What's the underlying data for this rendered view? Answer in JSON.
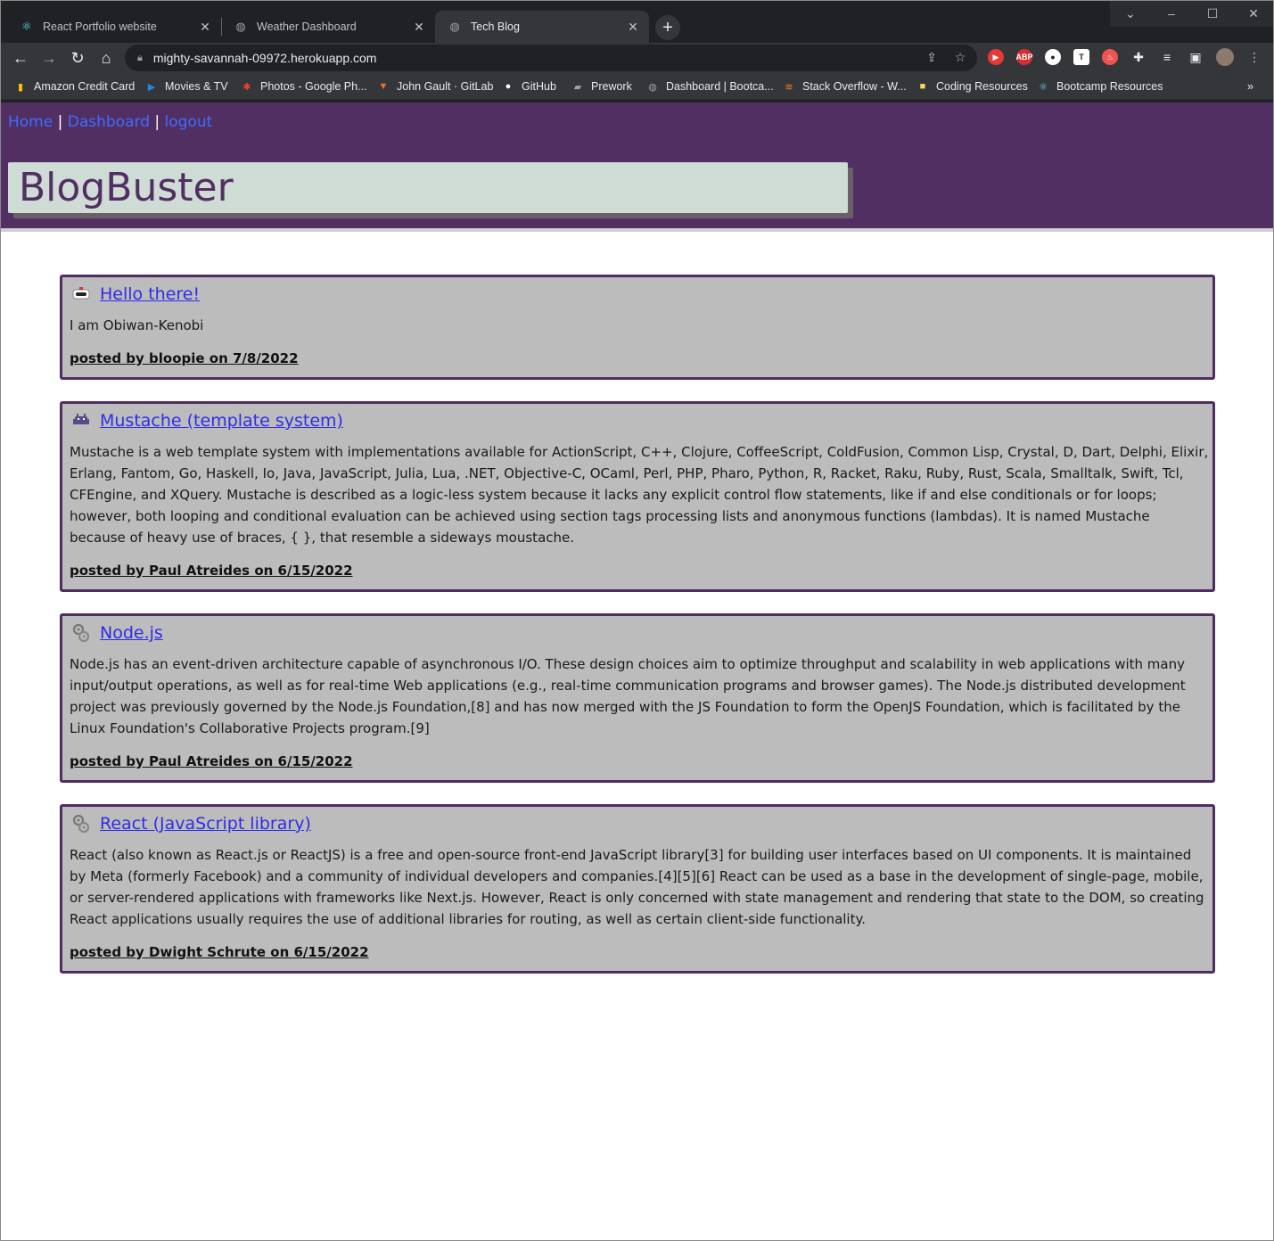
{
  "browser": {
    "tabs": [
      {
        "label": "React Portfolio website",
        "icon": "react-icon",
        "active": false
      },
      {
        "label": "Weather Dashboard",
        "icon": "globe-icon",
        "active": false
      },
      {
        "label": "Tech Blog",
        "icon": "globe-icon",
        "active": true
      }
    ],
    "url": "mighty-savannah-09972.herokuapp.com",
    "bookmarks": [
      {
        "label": "Amazon Credit Card",
        "icon": "chart-bars-icon"
      },
      {
        "label": "Movies & TV",
        "icon": "play-icon"
      },
      {
        "label": "Photos - Google Ph...",
        "icon": "pinwheel-icon"
      },
      {
        "label": "John Gault · GitLab",
        "icon": "gitlab-icon"
      },
      {
        "label": "GitHub",
        "icon": "github-icon"
      },
      {
        "label": "Prework",
        "icon": "book-icon"
      },
      {
        "label": "Dashboard | Bootca...",
        "icon": "globe-icon"
      },
      {
        "label": "Stack Overflow - W...",
        "icon": "stackoverflow-icon"
      },
      {
        "label": "Coding Resources",
        "icon": "folder-icon"
      },
      {
        "label": "Bootcamp Resources",
        "icon": "react-icon"
      }
    ],
    "bookmarks_overflow": "»"
  },
  "site": {
    "nav": {
      "home": "Home",
      "sep1": " | ",
      "dashboard": "Dashboard",
      "sep2": " | ",
      "logout": "logout"
    },
    "brand": "BlogBuster",
    "colors": {
      "header": "#522f63",
      "brand_box": "#cfdbd5",
      "post_bg": "#bcbcbc",
      "link": "#2f2de8"
    }
  },
  "posts": [
    {
      "title": "Hello there!",
      "icon": "robot-icon",
      "body": "I am Obiwan-Kenobi",
      "meta": "posted by bloopie on 7/8/2022"
    },
    {
      "title": "Mustache (template system)",
      "icon": "space-invader-icon",
      "body": "Mustache is a web template system with implementations available for ActionScript, C++, Clojure, CoffeeScript, ColdFusion, Common Lisp, Crystal, D, Dart, Delphi, Elixir, Erlang, Fantom, Go, Haskell, Io, Java, JavaScript, Julia, Lua, .NET, Objective-C, OCaml, Perl, PHP, Pharo, Python, R, Racket, Raku, Ruby, Rust, Scala, Smalltalk, Swift, Tcl, CFEngine, and XQuery. Mustache is described as a logic-less system because it lacks any explicit control flow statements, like if and else conditionals or for loops; however, both looping and conditional evaluation can be achieved using section tags processing lists and anonymous functions (lambdas). It is named Mustache because of heavy use of braces, { }, that resemble a sideways moustache.",
      "meta": "posted by Paul Atreides on 6/15/2022"
    },
    {
      "title": "Node.js",
      "icon": "gears-icon",
      "body": "Node.js has an event-driven architecture capable of asynchronous I/O. These design choices aim to optimize throughput and scalability in web applications with many input/output operations, as well as for real-time Web applications (e.g., real-time communication programs and browser games). The Node.js distributed development project was previously governed by the Node.js Foundation,[8] and has now merged with the JS Foundation to form the OpenJS Foundation, which is facilitated by the Linux Foundation's Collaborative Projects program.[9]",
      "meta": "posted by Paul Atreides on 6/15/2022"
    },
    {
      "title": "React (JavaScript library)",
      "icon": "gears-icon",
      "body": "React (also known as React.js or ReactJS) is a free and open-source front-end JavaScript library[3] for building user interfaces based on UI components. It is maintained by Meta (formerly Facebook) and a community of individual developers and companies.[4][5][6] React can be used as a base in the development of single-page, mobile, or server-rendered applications with frameworks like Next.js. However, React is only concerned with state management and rendering that state to the DOM, so creating React applications usually requires the use of additional libraries for routing, as well as certain client-side functionality.",
      "meta": "posted by Dwight Schrute on 6/15/2022"
    }
  ]
}
